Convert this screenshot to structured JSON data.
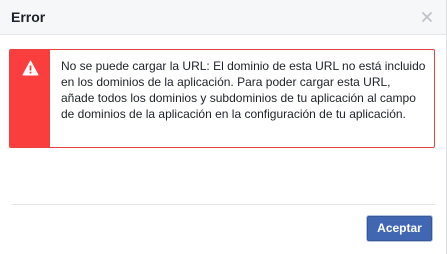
{
  "dialog": {
    "title": "Error",
    "close_icon": "close-icon",
    "alert": {
      "icon": "warning-icon",
      "message": "No se puede cargar la URL: El dominio de esta URL no está incluido en los dominios de la aplicación. Para poder cargar esta URL, añade todos los dominios y subdominios de tu aplicación al campo de dominios de la aplicación en la configuración de tu aplicación.",
      "color": "#fa3e3e"
    },
    "accept_label": "Aceptar",
    "accent_color": "#4267b2"
  }
}
